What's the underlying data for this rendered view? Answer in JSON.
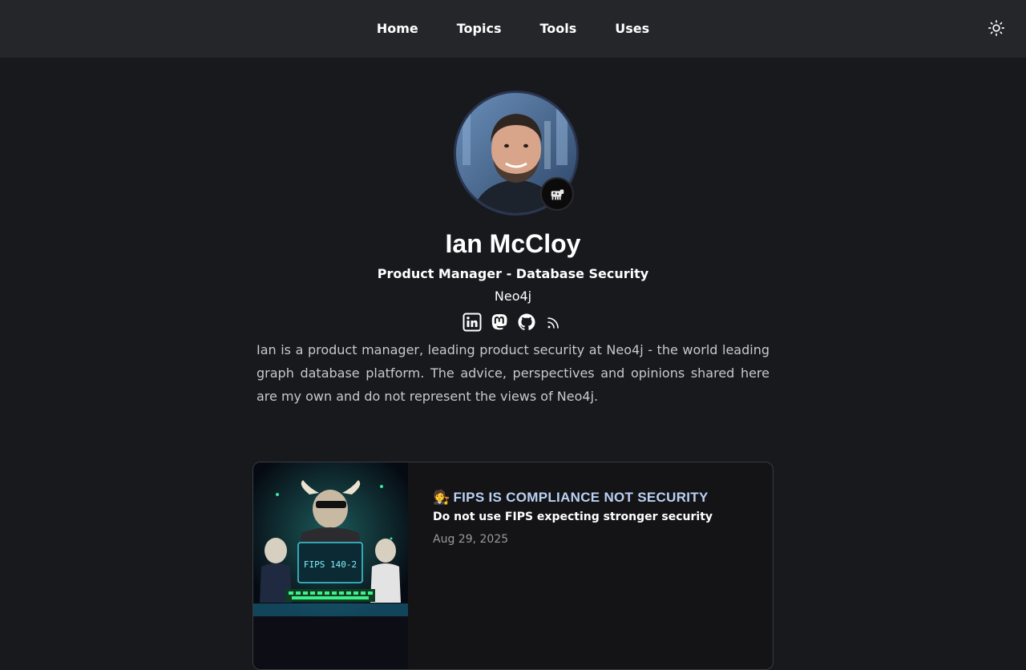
{
  "nav": {
    "items": [
      {
        "label": "Home"
      },
      {
        "label": "Topics"
      },
      {
        "label": "Tools"
      },
      {
        "label": "Uses"
      }
    ],
    "theme_toggle_icon": "sun-icon"
  },
  "profile": {
    "name": "Ian McCloy",
    "role": "Product Manager - Database Security",
    "company": "Neo4j",
    "bio": "Ian is a product manager, leading product security at Neo4j - the world leading graph database platform. The advice, perspectives and opinions shared here are my own and do not represent the views of Neo4j.",
    "socials": [
      {
        "icon": "linkedin-icon"
      },
      {
        "icon": "mastodon-icon"
      },
      {
        "icon": "github-icon"
      },
      {
        "icon": "rss-icon"
      }
    ]
  },
  "posts": [
    {
      "emoji": "🧑‍⚖️",
      "title": "FIPS IS COMPLIANCE NOT SECURITY",
      "subtitle": "Do not use FIPS expecting stronger security",
      "date": "Aug 29, 2025",
      "thumb_text": "FIPS 140-2"
    }
  ],
  "colors": {
    "background": "#18191d",
    "header": "#252629",
    "title_accent": "#b9d1f2",
    "date": "#9a9a9a"
  }
}
